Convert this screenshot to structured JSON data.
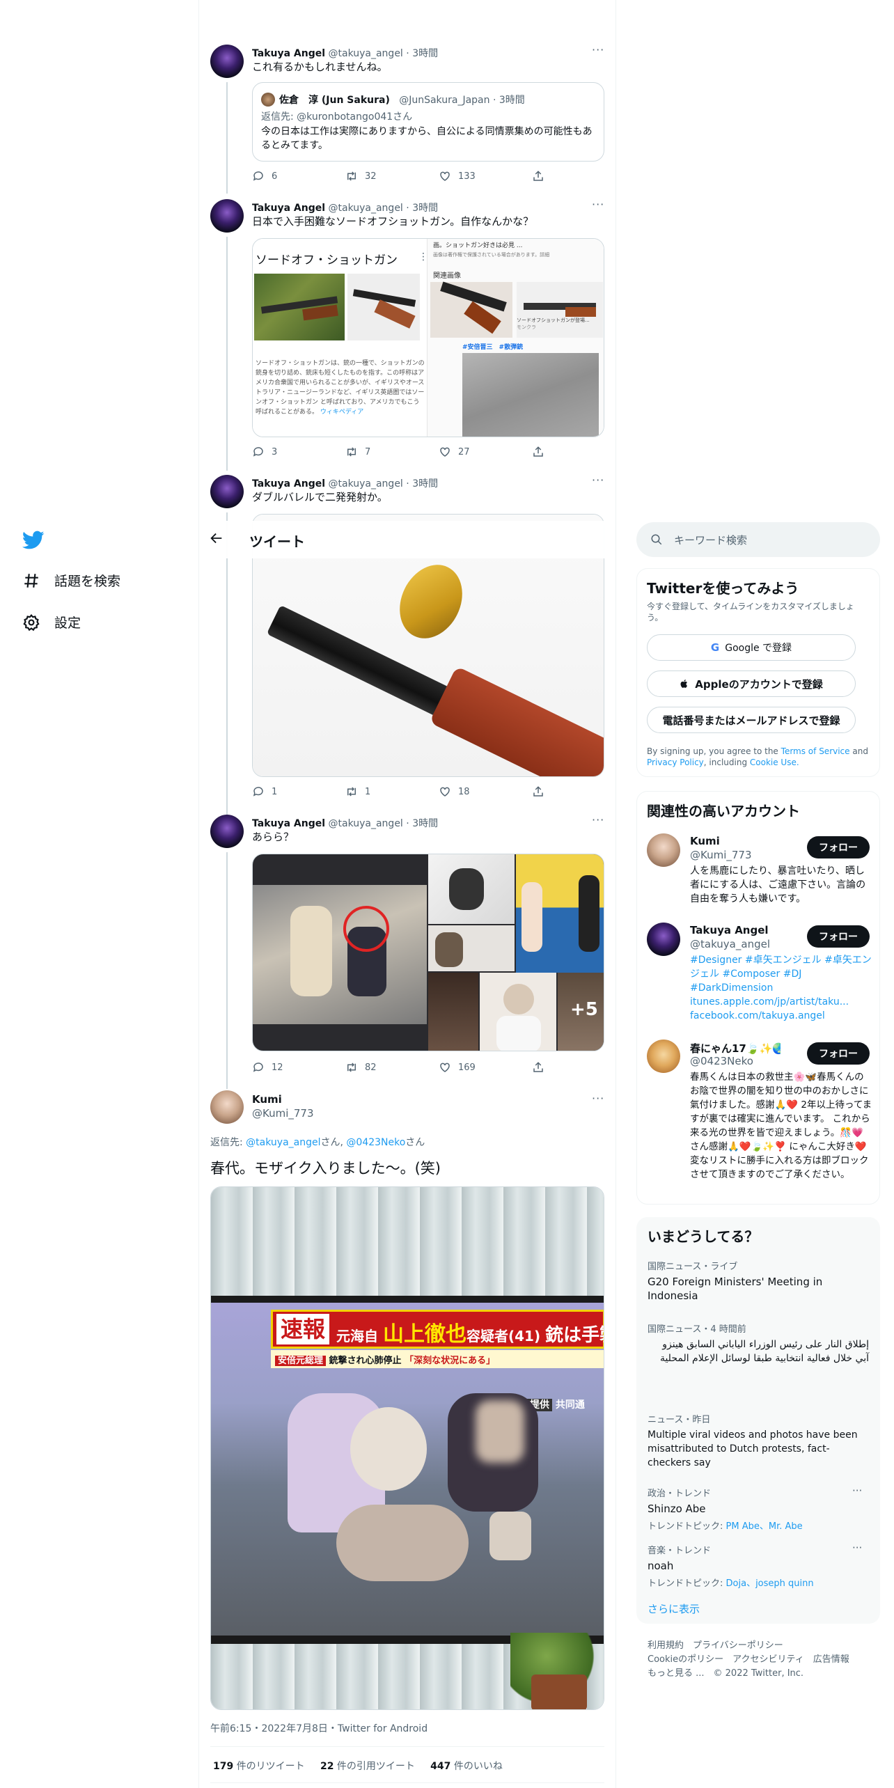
{
  "nav": {
    "explore": "話題を検索",
    "settings": "設定"
  },
  "header": {
    "title": "ツイート"
  },
  "tweets": [
    {
      "name": "Takuya Angel",
      "handle": "@takuya_angel",
      "time": "3時間",
      "text": "これ有るかもしれませんね。",
      "quote": {
        "name": "佐倉　淳 (Jun Sakura)",
        "handle": "@JunSakura_Japan",
        "time": "3時間",
        "reply_prefix": "返信先:",
        "reply_to": "@kuronbotango041さん",
        "text": "今の日本は工作は実際にありますから、自公による同情票集めの可能性もあるとみてます。"
      },
      "replies": "6",
      "retweets": "32",
      "likes": "133"
    },
    {
      "name": "Takuya Angel",
      "handle": "@takuya_angel",
      "time": "3時間",
      "text": "日本で入手困難なソードオフショットガン。自作なんかな？",
      "card": {
        "title": "ソードオフ・ショットガン",
        "desc": "ソードオフ・ショットガンは、銃の一種で、ショットガンの銃身を切り詰め、銃床も短くしたものを指す。この呼称はアメリカ合衆国で用いられることが多いが、イギリスやオーストラリア・ニュージーランドなど、イギリス英語圏ではソーンオフ・ショットガン と呼ばれており、アメリカでもこう呼ばれることがある。",
        "wiki": "ウィキペディア",
        "search_head": "画。ショットガン好きは必見 ...",
        "search_sub": "画像は著作権で保護されている場合があります。詳細",
        "related": "関連画像",
        "img_caption": "ソードオフショットガンが登場...",
        "img_caption2": "モンクラ",
        "tags": "#安倍晋三　#散弾銃"
      },
      "replies": "3",
      "retweets": "7",
      "likes": "27"
    },
    {
      "name": "Takuya Angel",
      "handle": "@takuya_angel",
      "time": "3時間",
      "text": "ダブルバレルで二発発射か。",
      "replies": "1",
      "retweets": "1",
      "likes": "18"
    },
    {
      "name": "Takuya Angel",
      "handle": "@takuya_angel",
      "time": "3時間",
      "text": "あらら？",
      "more_badge": "+5",
      "replies": "12",
      "retweets": "82",
      "likes": "169"
    }
  ],
  "main_tweet": {
    "name": "Kumi",
    "handle": "@Kumi_773",
    "reply_prefix": "返信先:",
    "reply_to_1": "@takuya_angel",
    "reply_sep": "さん, ",
    "reply_to_2": "@0423Neko",
    "reply_suffix": "さん",
    "text": "春代。モザイク入りました〜。(笑)",
    "tv_banner_1": "速報",
    "tv_banner_2": "元海自",
    "tv_banner_3": "山上徹也",
    "tv_banner_4": "容疑者(41)",
    "tv_banner_5": "銃は手製",
    "tv_sub_1": "安倍元総理",
    "tv_sub_2": "銃撃され心肺停止",
    "tv_sub_3": "「深刻な状況にある」",
    "tv_credit": "提供",
    "tv_credit2": "共同通",
    "meta": "午前6:15・2022年7月8日・Twitter for Android",
    "rt_count": "179",
    "rt_label": "件のリツイート",
    "quote_count": "22",
    "quote_label": "件の引用ツイート",
    "like_count": "447",
    "like_label": "件のいいね"
  },
  "sidebar": {
    "search_placeholder": "キーワード検索",
    "signup": {
      "title": "Twitterを使ってみよう",
      "sub": "今すぐ登録して、タイムラインをカスタマイズしましょう。",
      "google": "Google で登録",
      "apple": "Appleのアカウントで登録",
      "phone": "電話番号またはメールアドレスで登録",
      "legal_1": "By signing up, you agree to the",
      "tos": "Terms of Service",
      "legal_and": "and",
      "privacy": "Privacy Policy",
      "legal_2": ", including",
      "cookie": "Cookie Use."
    },
    "relevant": {
      "title": "関連性の高いアカウント",
      "follow": "フォロー",
      "accounts": [
        {
          "name": "Kumi",
          "handle": "@Kumi_773",
          "bio": "人を馬鹿にしたり、暴言吐いたり、晒し者ににする人は、ご遠慮下さい。言論の自由を奪う人も嫌いです。"
        },
        {
          "name": "Takuya Angel",
          "handle": "@takuya_angel",
          "bio_tags": "#Designer #卓矢エンジェル #卓矢エンジェル #Composer #DJ #DarkDimension",
          "link1": "itunes.apple.com/jp/artist/taku...",
          "link2": "facebook.com/takuya.angel"
        },
        {
          "name": "春にゃん17🍃✨🌏...",
          "handle": "@0423Neko",
          "bio": "春馬くんは日本の救世主🌸🦋春馬くんのお陰で世界の闇を知り世の中のおかしさに氣付けました。感謝🙏❤️ 2年以上待ってますが裏では確実に進んでいます。 これから来る光の世界を皆で迎えましょう。🎊💗さん感謝🙏❤️🍃✨❣️ にゃんこ大好き❤️ 変なリストに勝手に入れる方は即ブロックさせて頂きますのでご了承ください。"
        }
      ]
    },
    "trends": {
      "title": "いまどうしてる？",
      "items": [
        {
          "cat": "国際ニュース・ライブ",
          "name": "G20 Foreign Ministers' Meeting in Indonesia"
        },
        {
          "cat": "国際ニュース・4 時間前",
          "name": "إطلاق النار على رئيس الوزراء الياباني السابق هينزو آبي خلال فعالية انتخابية طبقا لوسائل الإعلام المحلية"
        },
        {
          "cat": "ニュース・昨日",
          "name": "Multiple viral videos and photos have been misattributed to Dutch protests, fact-checkers say"
        },
        {
          "cat": "政治・トレンド",
          "name": "Shinzo Abe",
          "sub_prefix": "トレンドトピック:",
          "sub_links": "PM Abe、Mr. Abe"
        },
        {
          "cat": "音楽・トレンド",
          "name": "noah",
          "sub_prefix": "トレンドトピック:",
          "sub_links": "Doja、joseph quinn"
        }
      ],
      "more": "さらに表示"
    },
    "footer": {
      "line1": "利用規約　プライバシーポリシー",
      "line2": "Cookieのポリシー　アクセシビリティ　広告情報",
      "line3": "もっと見る ...　© 2022 Twitter, Inc."
    }
  },
  "colors": {
    "accent": "#1d9bf0",
    "text": "#0f1419",
    "muted": "#536471",
    "border": "#cfd9de"
  }
}
